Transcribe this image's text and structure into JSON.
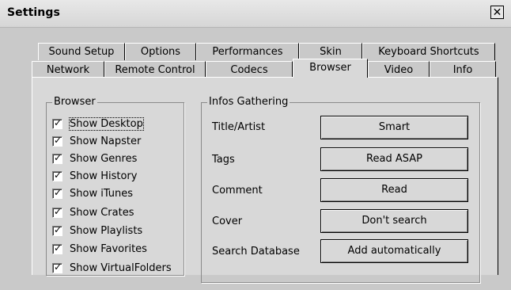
{
  "window": {
    "title": "Settings",
    "close_glyph": "✕",
    "close_icon": "close-icon"
  },
  "tabs": {
    "row1": [
      "Sound Setup",
      "Options",
      "Performances",
      "Skin",
      "Keyboard Shortcuts"
    ],
    "row2": [
      "Network",
      "Remote Control",
      "Codecs",
      "Browser",
      "Video",
      "Info"
    ],
    "active": "Browser"
  },
  "browser_group": {
    "title": "Browser",
    "items": [
      {
        "label": "Show Desktop",
        "checked": true
      },
      {
        "label": "Show Napster",
        "checked": true
      },
      {
        "label": "Show Genres",
        "checked": true
      },
      {
        "label": "Show History",
        "checked": true
      },
      {
        "label": "Show iTunes",
        "checked": true
      },
      {
        "label": "Show Crates",
        "checked": true
      },
      {
        "label": "Show Playlists",
        "checked": true
      },
      {
        "label": "Show Favorites",
        "checked": true
      },
      {
        "label": "Show VirtualFolders",
        "checked": true
      }
    ]
  },
  "infos_group": {
    "title": "Infos Gathering",
    "rows": [
      {
        "label": "Title/Artist",
        "value": "Smart"
      },
      {
        "label": "Tags",
        "value": "Read ASAP"
      },
      {
        "label": "Comment",
        "value": "Read"
      },
      {
        "label": "Cover",
        "value": "Don't search"
      },
      {
        "label": "Search Database",
        "value": "Add automatically"
      }
    ]
  }
}
